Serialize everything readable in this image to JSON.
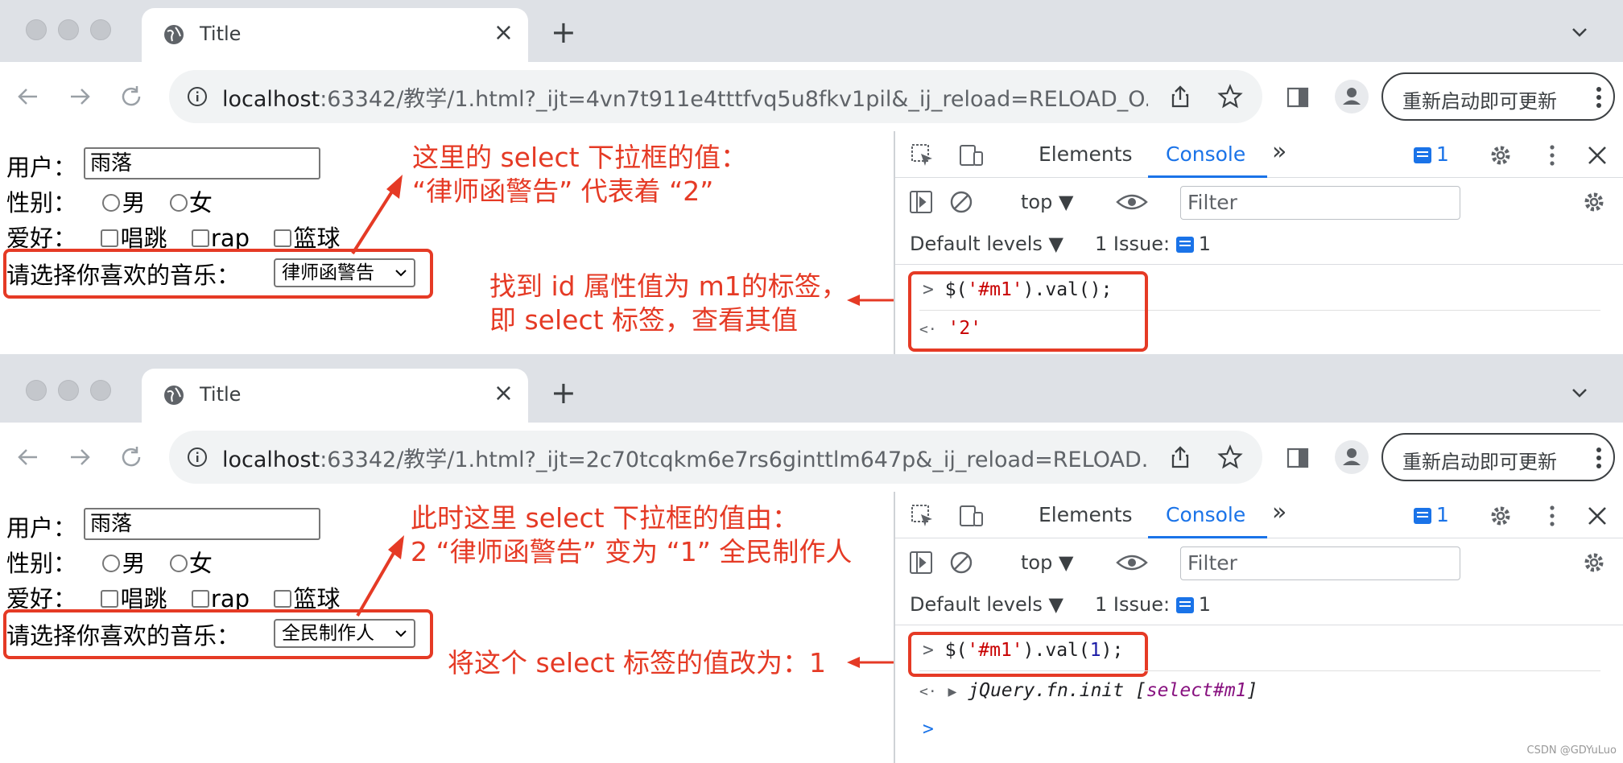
{
  "window1": {
    "tab_title": "Title",
    "new_tab": "+",
    "close": "×",
    "url_host": "localhost",
    "url_rest": ":63342/教学/1.html?_ijt=4vn7t911e4tttfvq5u8fkv1pil&_ij_reload=RELOAD_O...",
    "update_button": "重新启动即可更新",
    "form": {
      "user_label": "用户：",
      "user_value": "雨落",
      "gender_label": "性别：",
      "male": "男",
      "female": "女",
      "hobby_label": "爱好：",
      "hobbies": [
        "唱跳",
        "rap",
        "篮球"
      ],
      "music_label": "请选择你喜欢的音乐：",
      "music_selected": "律师函警告"
    },
    "notes": {
      "top_line1": "这里的 select 下拉框的值：",
      "top_line2": "“律师函警告” 代表着 “2”",
      "mid_line1": "找到 id 属性值为 m1的标签，",
      "mid_line2": "即 select 标签，查看其值"
    },
    "devtools": {
      "tabs": [
        "Elements",
        "Console"
      ],
      "more": "»",
      "issue_badge": "1",
      "context": "top",
      "filter_placeholder": "Filter",
      "levels": "Default levels ▼",
      "issues": "1 Issue:",
      "issues_count": "1",
      "input_prompt": ">",
      "input_code_prefix": "$(",
      "input_code_str": "'#m1'",
      "input_code_suffix": ").val();",
      "output_prompt": "<·",
      "output_value": "'2'"
    }
  },
  "window2": {
    "tab_title": "Title",
    "new_tab": "+",
    "close": "×",
    "url_host": "localhost",
    "url_rest": ":63342/教学/1.html?_ijt=2c70tcqkm6e7rs6ginttlm647p&_ij_reload=RELOAD...",
    "update_button": "重新启动即可更新",
    "form": {
      "user_label": "用户：",
      "user_value": "雨落",
      "gender_label": "性别：",
      "male": "男",
      "female": "女",
      "hobby_label": "爱好：",
      "hobbies": [
        "唱跳",
        "rap",
        "篮球"
      ],
      "music_label": "请选择你喜欢的音乐：",
      "music_selected": "全民制作人"
    },
    "notes": {
      "top_line1": "此时这里 select 下拉框的值由：",
      "top_line2": "2 “律师函警告” 变为 “1” 全民制作人",
      "mid_line1": "将这个 select 标签的值改为：1"
    },
    "devtools": {
      "tabs": [
        "Elements",
        "Console"
      ],
      "more": "»",
      "issue_badge": "1",
      "context": "top",
      "filter_placeholder": "Filter",
      "levels": "Default levels ▼",
      "issues": "1 Issue:",
      "issues_count": "1",
      "input_prompt": ">",
      "input_code_prefix": "$(",
      "input_code_str": "'#m1'",
      "input_code_mid": ").val(",
      "input_code_num": "1",
      "input_code_suffix": ");",
      "output_prompt": "<·",
      "output_italic": "jQuery.fn.init [",
      "output_purple": "select#m1",
      "output_close": "]",
      "next_prompt": ">"
    }
  },
  "watermark": "CSDN @GDYuLuo",
  "colors": {
    "annotation": "#e53a25",
    "accent": "#1a73e8"
  }
}
